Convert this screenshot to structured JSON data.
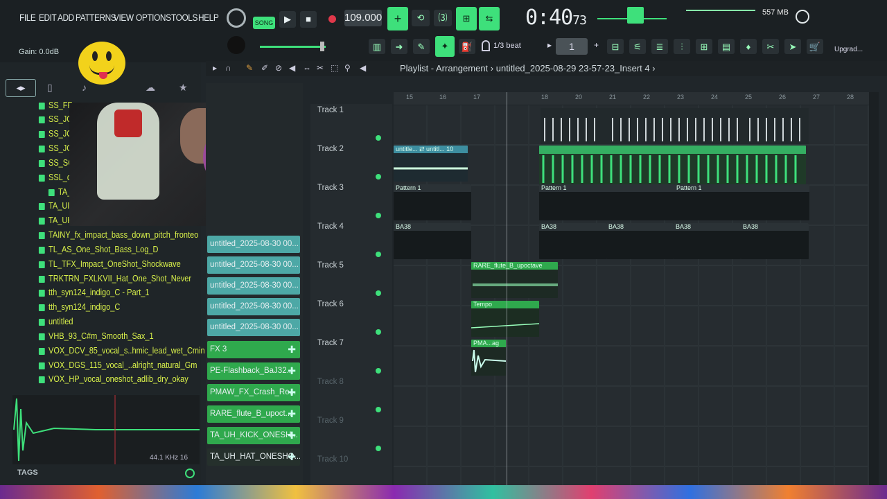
{
  "menu": [
    "FILE",
    "EDIT",
    "ADD",
    "PATTERNS",
    "VIEW",
    "OPTIONS",
    "TOOLS",
    "HELP"
  ],
  "transport": {
    "mode": "SONG",
    "tempo": "109.000",
    "time_main": "0:40",
    "time_ticks": "73",
    "memory": "557 MB",
    "gain": "Gain: 0.0dB",
    "snap": "1/3 beat",
    "pattern_number": "1",
    "update_label": "Upgrad..."
  },
  "playlist": {
    "title": "Playlist - Arrangement",
    "file": "untitled_2025-08-29 23-57-23_Insert 4",
    "ruler": [
      "15",
      "16",
      "17",
      "18",
      "19",
      "20",
      "21",
      "22",
      "23",
      "24",
      "25",
      "26",
      "27",
      "28"
    ],
    "tracks": [
      "Track 1",
      "Track 2",
      "Track 3",
      "Track 4",
      "Track 5",
      "Track 6",
      "Track 7",
      "Track 8",
      "Track 9",
      "Track 10"
    ],
    "clips": {
      "t2a": "untitle... ⇄ untitl... 10",
      "t3": "Pattern 1",
      "t4": "BA38",
      "t5": "RARE_flute_B_upoctave",
      "t6": "Tempo",
      "t7": "PMA...ag"
    }
  },
  "browser": {
    "items": [
      "SS_FF...",
      "SS_JG...",
      "SS_JO...",
      "SS_JG...",
      "SS_SC...",
      "SSL_d...",
      "TA_...",
      "TA_UI...",
      "TA_UH_KICK_ONESHOT_SHORT",
      "TAINY_fx_impact_bass_down_pitch_fronteo",
      "TL_AS_One_Shot_Bass_Log_D",
      "TL_TFX_Impact_OneShot_Shockwave",
      "TRKTRN_FXLKVII_Hat_One_Shot_Never",
      "tth_syn124_indigo_C - Part_1",
      "tth_syn124_indigo_C",
      "untitled",
      "VHB_93_C#m_Smooth_Sax_1",
      "VOX_DCV_85_vocal_s..hmic_lead_wet_Cmin",
      "VOX_DGS_115_vocal_..alright_natural_Gm",
      "VOX_HP_vocal_oneshot_adlib_dry_okay"
    ],
    "sample_rate": "44.1 KHz 16",
    "tags": "TAGS"
  },
  "channels": [
    {
      "label": "untitled_2025-08-30 00...",
      "color": "teal"
    },
    {
      "label": "untitled_2025-08-30 00...",
      "color": "teal"
    },
    {
      "label": "untitled_2025-08-30 00...",
      "color": "teal"
    },
    {
      "label": "untitled_2025-08-30 00...",
      "color": "teal"
    },
    {
      "label": "untitled_2025-08-30 00...",
      "color": "teal"
    },
    {
      "label": "FX 3",
      "color": "green"
    },
    {
      "label": "PE-Flashback_BaJ32...",
      "color": "green"
    },
    {
      "label": "PMAW_FX_Crash_Re...",
      "color": "green"
    },
    {
      "label": "RARE_flute_B_upoct...",
      "color": "green"
    },
    {
      "label": "TA_UH_KICK_ONESH...",
      "color": "green"
    },
    {
      "label": "TA_UH_HAT_ONESHO...",
      "color": "green"
    }
  ]
}
